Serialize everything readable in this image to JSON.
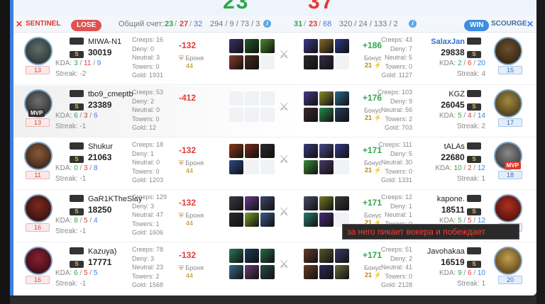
{
  "banner": {
    "left_score": "23",
    "right_score": "37"
  },
  "header": {
    "sentinel_label": "SENTINEL",
    "lose_label": "LOSE",
    "total_label": "Общий счет:",
    "left_kills": "23",
    "sep1": "/",
    "left_deaths": "27",
    "sep2": "/",
    "left_assists": "32",
    "left_extra": "294 / 9 / 73 / 3",
    "right_kills": "31",
    "sep3": "/",
    "right_deaths": "23",
    "sep4": "/",
    "right_assists": "68",
    "right_extra": "320 / 24 / 133 / 2",
    "win_label": "WIN",
    "scourge_label": "SCOURGE",
    "info_glyph": "i"
  },
  "labels": {
    "creeps": "Creeps:",
    "deny": "Deny:",
    "neutral": "Neutral:",
    "towers": "Towers:",
    "gold": "Gold:",
    "kda": "KDA:",
    "streak": "Streak:",
    "armor": "Броня",
    "bonus": "Бонус",
    "mvp": "MVP"
  },
  "players": [
    {
      "left": {
        "name": "MIWA-N1",
        "mmr": "30019",
        "kda_k": "3",
        "kda_d": "11",
        "kda_a": "9",
        "streak": "-2",
        "level": "13",
        "creeps": "16",
        "deny": "0",
        "neutral": "3",
        "towers": "0",
        "gold": "1931",
        "delta": "-132",
        "armor": "44"
      },
      "right": {
        "name": "SalaxJan",
        "mmr": "29838",
        "kda_k": "2",
        "kda_d": "6",
        "kda_a": "20",
        "streak": "4",
        "level": "15",
        "creeps": "43",
        "deny": "7",
        "neutral": "5",
        "towers": "0",
        "gold": "1127",
        "delta": "+186",
        "bonus": "21"
      }
    },
    {
      "left": {
        "name": "tbo9_cmeptb",
        "mmr": "23389",
        "kda_k": "6",
        "kda_d": "3",
        "kda_a": "6",
        "streak": "-1",
        "level": "13",
        "creeps": "53",
        "deny": "2",
        "neutral": "0",
        "towers": "0",
        "gold": "12",
        "delta": "-412",
        "armor": ""
      },
      "right": {
        "name": "KGZ",
        "mmr": "26045",
        "kda_k": "5",
        "kda_d": "4",
        "kda_a": "14",
        "streak": "2",
        "level": "17",
        "creeps": "103",
        "deny": "9",
        "neutral": "56",
        "towers": "2",
        "gold": "703",
        "delta": "+176",
        "bonus": "21"
      }
    },
    {
      "left": {
        "name": "Shukur",
        "mmr": "21063",
        "kda_k": "0",
        "kda_d": "3",
        "kda_a": "8",
        "streak": "-1",
        "level": "11",
        "creeps": "18",
        "deny": "1",
        "neutral": "0",
        "towers": "0",
        "gold": "1203",
        "delta": "-132",
        "armor": "44"
      },
      "right": {
        "name": "tALAs",
        "mmr": "22680",
        "kda_k": "10",
        "kda_d": "2",
        "kda_a": "12",
        "streak": "1",
        "level": "18",
        "creeps": "111",
        "deny": "5",
        "neutral": "30",
        "towers": "0",
        "gold": "1331",
        "delta": "+171",
        "bonus": "21"
      }
    },
    {
      "left": {
        "name": "GaR1KTheSlay",
        "mmr": "18250",
        "kda_k": "8",
        "kda_d": "5",
        "kda_a": "4",
        "streak": "-1",
        "level": "16",
        "creeps": "129",
        "deny": "3",
        "neutral": "47",
        "towers": "1",
        "gold": "1606",
        "delta": "-132",
        "armor": "44"
      },
      "right": {
        "name": "kapone.",
        "mmr": "18511",
        "kda_k": "5",
        "kda_d": "5",
        "kda_a": "12",
        "streak": "1",
        "level": "14",
        "creeps": "12",
        "deny": "1",
        "neutral": "1",
        "towers": "0",
        "gold": "",
        "delta": "+171",
        "bonus": "21"
      }
    },
    {
      "left": {
        "name": "Kazuya)",
        "mmr": "17771",
        "kda_k": "6",
        "kda_d": "5",
        "kda_a": "5",
        "streak": "-1",
        "level": "16",
        "creeps": "78",
        "deny": "3",
        "neutral": "23",
        "towers": "2",
        "gold": "1568",
        "delta": "-132",
        "armor": "44"
      },
      "right": {
        "name": "Javohakaa",
        "mmr": "16519",
        "kda_k": "9",
        "kda_d": "6",
        "kda_a": "10",
        "streak": "1",
        "level": "20",
        "creeps": "51",
        "deny": "2",
        "neutral": "41",
        "towers": "0",
        "gold": "2128",
        "delta": "+171",
        "bonus": "21"
      }
    }
  ],
  "tooltip": "за него пикает вокера и побеждает",
  "colors": {
    "win": "#2fa84a",
    "lose": "#e53935",
    "accent": "#3d7fe0"
  }
}
